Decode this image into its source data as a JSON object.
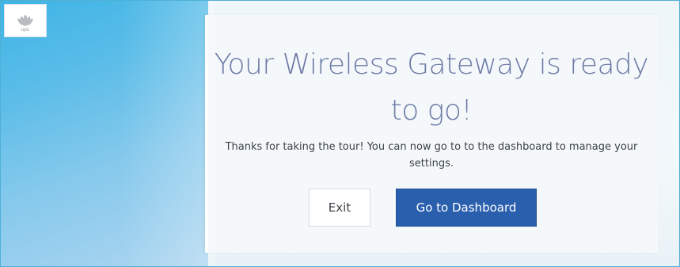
{
  "brand": {
    "logo_text": "upc",
    "logo_icon": "upc-logo-icon"
  },
  "tour_complete": {
    "headline": "Your Wireless Gateway is ready to go!",
    "message": "Thanks for taking the tour! You can now go to to the dashboard to manage your settings.",
    "exit_label": "Exit",
    "dashboard_label": "Go to Dashboard"
  },
  "colors": {
    "accent_blue": "#2a5fae",
    "headline": "#6d7ca6",
    "sidebar_blue": "#3eb4e6",
    "border": "#4fb0d6"
  }
}
